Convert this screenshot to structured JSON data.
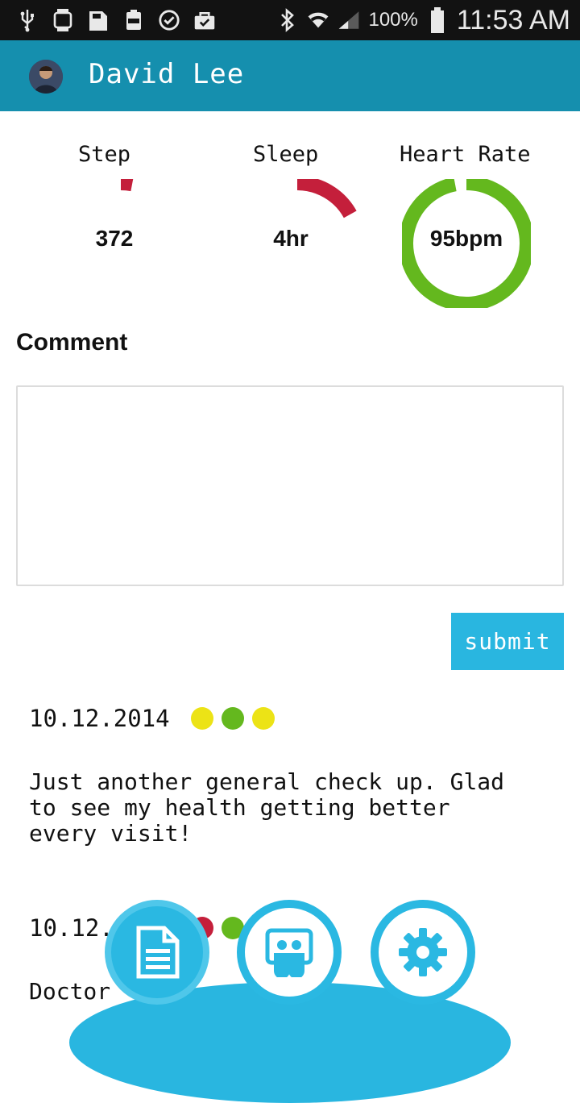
{
  "status_bar": {
    "battery_percent": "100%",
    "time": "11:53 AM",
    "icons": [
      "usb-icon",
      "watch-icon",
      "galaxy-card-icon",
      "battery-100-icon",
      "check-circle-icon",
      "shopping-bag-icon",
      "bluetooth-icon",
      "wifi-icon",
      "signal-icon",
      "battery-icon"
    ]
  },
  "header": {
    "user_name": "David Lee",
    "background_color": "#158fae"
  },
  "metrics": [
    {
      "label": "Step",
      "value": "372",
      "progress_fraction": 0.03,
      "color": "#c41f3b"
    },
    {
      "label": "Sleep",
      "value": "4hr",
      "progress_fraction": 0.17,
      "color": "#c41f3b"
    },
    {
      "label": "Heart Rate",
      "value": "95bpm",
      "progress_fraction": 0.97,
      "color": "#64b81e"
    }
  ],
  "comment": {
    "heading": "Comment",
    "value": "",
    "submit_label": "submit"
  },
  "entries": [
    {
      "date": "10.12.2014",
      "indicator_colors": [
        "#ece316",
        "#64b81e",
        "#ece316"
      ],
      "text": "Just another general check up. Glad\nto see my health getting better\nevery visit!"
    },
    {
      "date": "10.12.",
      "indicator_colors": [
        "#c41f3b",
        "#64b81e"
      ],
      "text": "Doctor"
    }
  ],
  "bottom_nav": {
    "items": [
      {
        "icon": "document-icon"
      },
      {
        "icon": "share-icon"
      },
      {
        "icon": "settings-icon"
      }
    ],
    "accent_color": "#29b6e0"
  }
}
